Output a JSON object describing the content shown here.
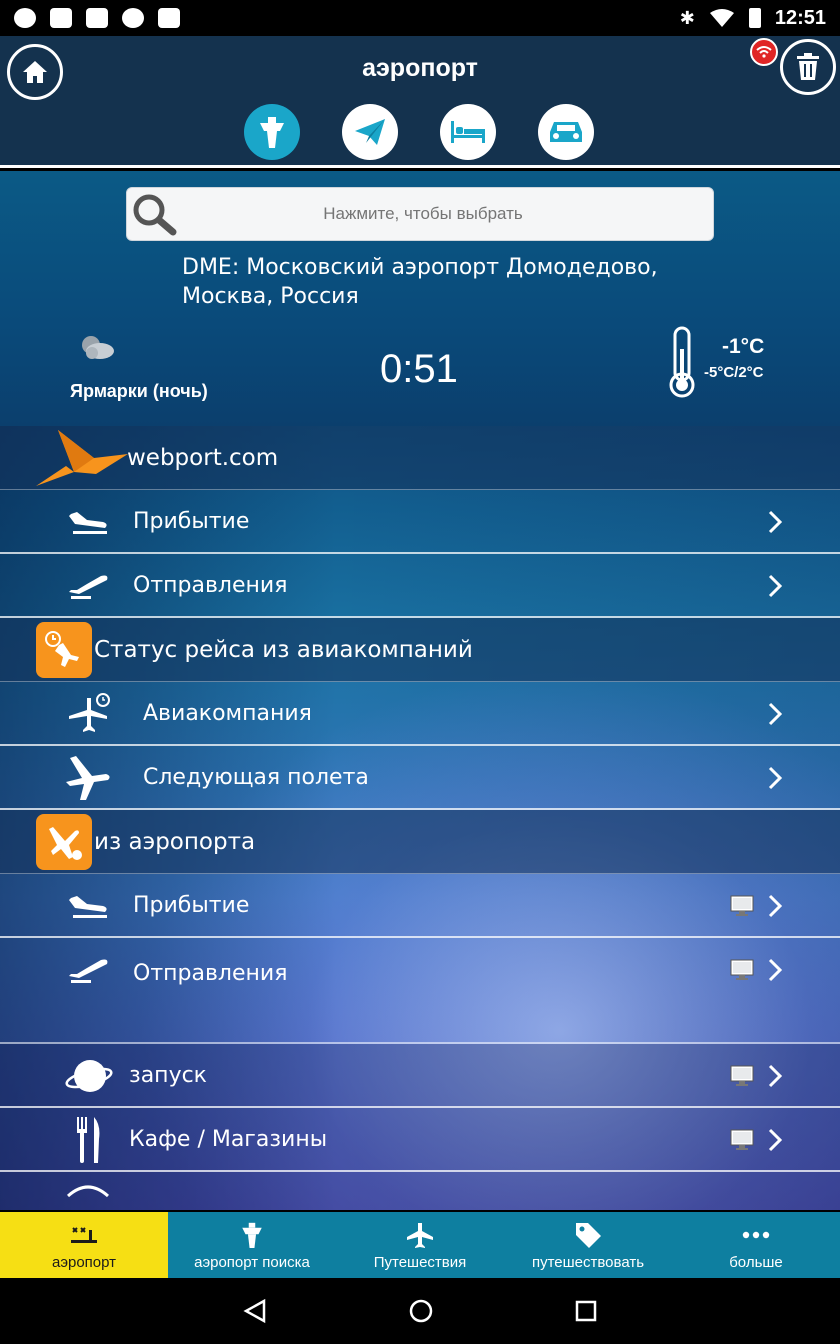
{
  "statusbar": {
    "time": "12:51"
  },
  "header": {
    "title": "аэропорт"
  },
  "search": {
    "placeholder": "Нажмите, чтобы выбрать"
  },
  "airport": {
    "name": "DME: Московский аэропорт Домодедово, Москва, Россия"
  },
  "weather": {
    "place": "Ярмарки (ночь)",
    "time": "0:51",
    "temp_now": "-1°C",
    "temp_range": "-5°C/2°C"
  },
  "sections": {
    "webport": {
      "label": "webport.com",
      "arrivals": "Прибытие",
      "departures": "Отправления"
    },
    "status": {
      "label": "Статус рейса из авиакомпаний",
      "airline": "Авиакомпания",
      "next": "Следующая полета"
    },
    "from_airport": {
      "label": "из аэропорта",
      "arrivals": "Прибытие",
      "departures": "Отправления"
    },
    "extras": {
      "launch": "запуск",
      "cafe": "Кафе / Магазины"
    }
  },
  "bottom_nav": {
    "airport": "аэропорт",
    "search": "аэропорт поиска",
    "travel": "Путешествия",
    "trip": "путешествовать",
    "more": "больше"
  },
  "colors": {
    "header_bg": "#14324e",
    "accent": "#1aa6c9",
    "nav_bg": "#0e7fa0",
    "nav_active": "#f6df14",
    "orange": "#f7941d"
  }
}
